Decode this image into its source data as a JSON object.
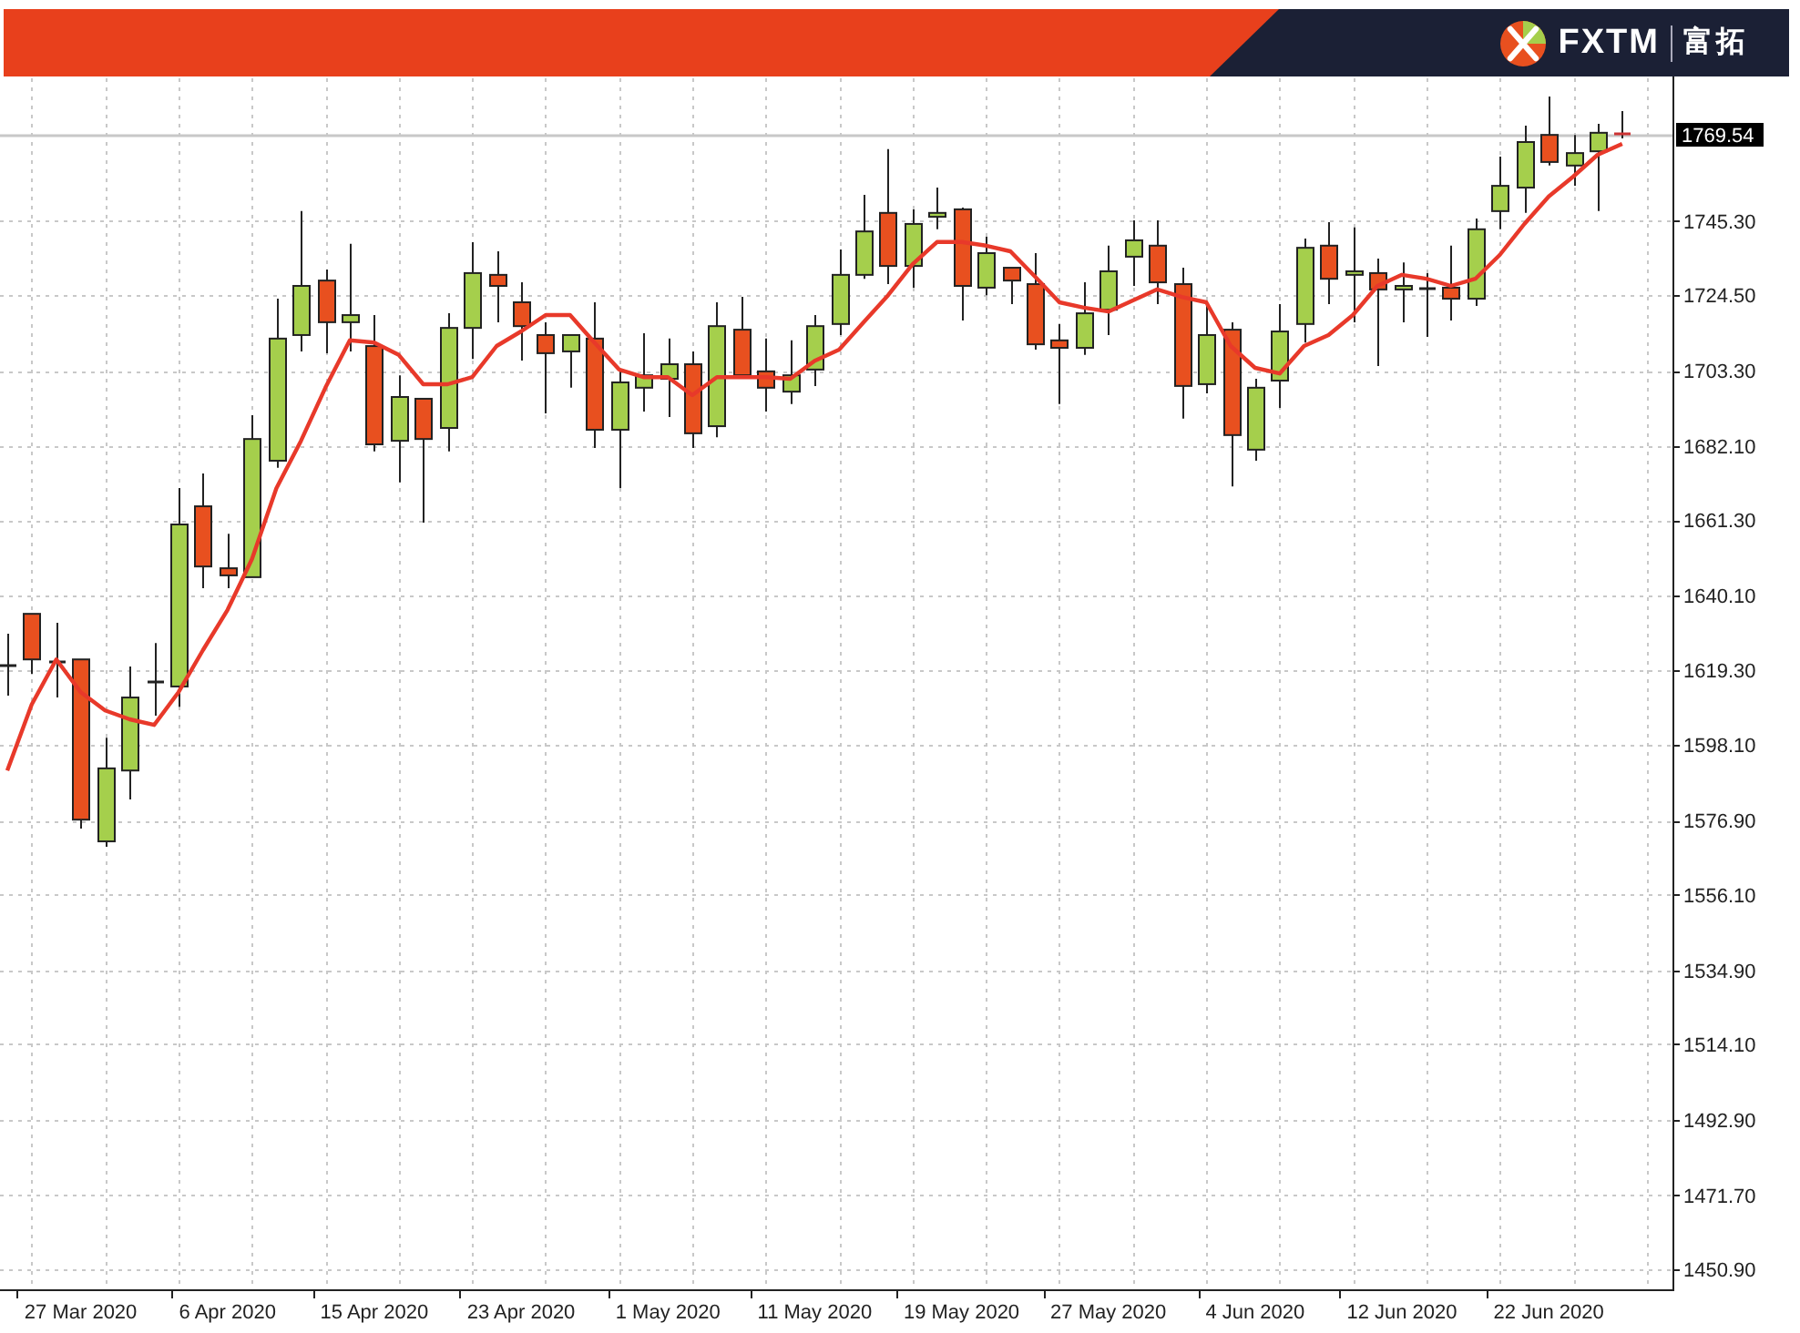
{
  "header": {
    "brand": "FXTM",
    "brand_chinese": "富拓"
  },
  "chart": {
    "chart_data": {
      "type": "candlestick",
      "grid": true,
      "ylim": [
        1445.3,
        1785.4
      ],
      "categories": [
        null,
        null,
        null,
        "27 Mar 2020",
        null,
        null,
        null,
        null,
        null,
        "6 Apr 2020",
        null,
        null,
        null,
        null,
        null,
        "15 Apr 2020",
        null,
        null,
        null,
        null,
        null,
        "23 Apr 2020",
        null,
        null,
        null,
        null,
        null,
        "1 May 2020",
        null,
        null,
        null,
        null,
        null,
        "11 May 2020",
        null,
        null,
        null,
        null,
        null,
        "19 May 2020",
        null,
        null,
        null,
        null,
        null,
        "27 May 2020",
        null,
        null,
        null,
        null,
        null,
        "4 Jun 2020",
        null,
        null,
        null,
        null,
        null,
        "12 Jun 2020",
        null,
        null,
        null,
        null,
        null,
        "22 Jun 2020",
        null,
        null,
        null
      ],
      "yticks": [
        {
          "value": 1745.3,
          "label": "1745.30"
        },
        {
          "value": 1724.5,
          "label": "1724.50"
        },
        {
          "value": 1703.3,
          "label": "1703.30"
        },
        {
          "value": 1682.1,
          "label": "1682.10"
        },
        {
          "value": 1661.3,
          "label": "1661.30"
        },
        {
          "value": 1640.1,
          "label": "1640.10"
        },
        {
          "value": 1619.3,
          "label": "1619.30"
        },
        {
          "value": 1598.1,
          "label": "1598.10"
        },
        {
          "value": 1576.9,
          "label": "1576.90"
        },
        {
          "value": 1556.1,
          "label": "1556.10"
        },
        {
          "value": 1534.9,
          "label": "1534.90"
        },
        {
          "value": 1514.1,
          "label": "1514.10"
        },
        {
          "value": 1492.9,
          "label": "1492.90"
        },
        {
          "value": 1471.7,
          "label": "1471.70"
        },
        {
          "value": 1450.9,
          "label": "1450.90"
        }
      ],
      "ohlc": [
        [
          1620.7,
          1629.4,
          1612.0,
          1620.7
        ],
        [
          1635.0,
          1635.0,
          1618.1,
          1622.2
        ],
        [
          1621.7,
          1632.5,
          1611.5,
          1621.7
        ],
        [
          1622.2,
          1622.2,
          1574.7,
          1577.2
        ],
        [
          1571.1,
          1600.2,
          1569.6,
          1591.6
        ],
        [
          1591.0,
          1620.2,
          1582.9,
          1611.5
        ],
        [
          1616.1,
          1626.8,
          1606.4,
          1616.1
        ],
        [
          1614.6,
          1670.3,
          1608.9,
          1660.1
        ],
        [
          1665.2,
          1674.4,
          1642.2,
          1648.3
        ],
        [
          1647.8,
          1657.5,
          1642.2,
          1645.8
        ],
        [
          1645.3,
          1690.8,
          1645.3,
          1684.1
        ],
        [
          1678.0,
          1723.5,
          1676.0,
          1712.3
        ],
        [
          1713.3,
          1748.1,
          1708.7,
          1727.1
        ],
        [
          1728.6,
          1731.7,
          1708.2,
          1716.9
        ],
        [
          1716.9,
          1738.9,
          1708.7,
          1718.9
        ],
        [
          1710.2,
          1718.9,
          1680.6,
          1682.6
        ],
        [
          1683.6,
          1702.0,
          1671.9,
          1695.9
        ],
        [
          1695.4,
          1695.4,
          1660.6,
          1684.1
        ],
        [
          1687.2,
          1719.4,
          1680.6,
          1715.3
        ],
        [
          1715.3,
          1739.4,
          1706.6,
          1730.7
        ],
        [
          1730.2,
          1736.8,
          1716.9,
          1727.1
        ],
        [
          1722.5,
          1728.1,
          1706.1,
          1715.8
        ],
        [
          1713.3,
          1716.9,
          1691.3,
          1708.2
        ],
        [
          1708.7,
          1713.3,
          1698.5,
          1713.3
        ],
        [
          1712.3,
          1722.5,
          1681.6,
          1686.7
        ],
        [
          1686.7,
          1703.6,
          1670.3,
          1700.0
        ],
        [
          1698.5,
          1713.8,
          1691.8,
          1702.0
        ],
        [
          1701.0,
          1712.3,
          1690.3,
          1705.1
        ],
        [
          1705.1,
          1708.7,
          1681.6,
          1685.7
        ],
        [
          1687.7,
          1722.5,
          1684.6,
          1715.8
        ],
        [
          1714.8,
          1724.0,
          1702.0,
          1702.0
        ],
        [
          1703.1,
          1712.3,
          1691.8,
          1698.5
        ],
        [
          1697.4,
          1711.8,
          1693.9,
          1702.0
        ],
        [
          1703.6,
          1718.9,
          1699.0,
          1715.8
        ],
        [
          1716.4,
          1737.3,
          1713.3,
          1730.2
        ],
        [
          1730.2,
          1752.7,
          1729.1,
          1742.4
        ],
        [
          1747.6,
          1765.5,
          1727.6,
          1732.7
        ],
        [
          1732.7,
          1748.6,
          1726.6,
          1744.5
        ],
        [
          1746.5,
          1754.7,
          1743.0,
          1747.6
        ],
        [
          1748.6,
          1749.1,
          1717.4,
          1727.1
        ],
        [
          1726.6,
          1740.9,
          1724.5,
          1736.3
        ],
        [
          1732.2,
          1732.2,
          1722.0,
          1728.6
        ],
        [
          1727.6,
          1736.3,
          1709.2,
          1710.7
        ],
        [
          1711.8,
          1716.4,
          1693.9,
          1709.7
        ],
        [
          1709.7,
          1728.1,
          1707.7,
          1719.4
        ],
        [
          1720.4,
          1738.4,
          1713.3,
          1731.2
        ],
        [
          1735.3,
          1745.5,
          1727.1,
          1739.9
        ],
        [
          1738.4,
          1745.5,
          1722.0,
          1728.1
        ],
        [
          1727.6,
          1732.2,
          1689.8,
          1699.0
        ],
        [
          1699.5,
          1721.5,
          1696.9,
          1713.3
        ],
        [
          1714.8,
          1716.9,
          1670.8,
          1685.2
        ],
        [
          1681.1,
          1701.0,
          1678.0,
          1698.5
        ],
        [
          1700.5,
          1722.0,
          1692.8,
          1714.3
        ],
        [
          1716.4,
          1740.4,
          1711.2,
          1737.8
        ],
        [
          1738.4,
          1745.0,
          1722.0,
          1729.1
        ],
        [
          1730.2,
          1743.5,
          1716.9,
          1731.2
        ],
        [
          1730.7,
          1734.8,
          1704.6,
          1726.1
        ],
        [
          1726.1,
          1733.7,
          1716.9,
          1727.1
        ],
        [
          1726.1,
          1730.7,
          1712.8,
          1726.6
        ],
        [
          1726.6,
          1738.4,
          1717.4,
          1723.5
        ],
        [
          1723.5,
          1746.0,
          1721.5,
          1743.0
        ],
        [
          1748.1,
          1763.4,
          1743.0,
          1755.2
        ],
        [
          1754.7,
          1772.1,
          1747.6,
          1767.5
        ],
        [
          1769.5,
          1780.3,
          1760.9,
          1761.9
        ],
        [
          1760.9,
          1769.5,
          1755.2,
          1764.4
        ],
        [
          1764.9,
          1772.6,
          1748.1,
          1770.1
        ],
        [
          1770.1,
          1776.2,
          1768.5,
          1769.5
        ]
      ],
      "series": [
        {
          "type": "line",
          "color": "#e8392a",
          "values": [
            1591.0,
            1609.5,
            1622.2,
            1613.0,
            1607.9,
            1605.4,
            1603.8,
            1613.0,
            1624.8,
            1636.1,
            1650.4,
            1670.3,
            1683.6,
            1698.5,
            1711.8,
            1711.2,
            1707.7,
            1699.5,
            1699.5,
            1701.5,
            1710.2,
            1714.3,
            1718.9,
            1718.9,
            1711.2,
            1703.6,
            1701.5,
            1701.5,
            1696.4,
            1701.5,
            1701.5,
            1701.5,
            1701.0,
            1706.1,
            1709.2,
            1716.9,
            1724.5,
            1733.2,
            1739.4,
            1739.4,
            1738.4,
            1736.8,
            1729.7,
            1722.5,
            1721.0,
            1719.9,
            1723.0,
            1726.1,
            1724.0,
            1722.5,
            1710.2,
            1704.1,
            1702.5,
            1710.2,
            1713.3,
            1718.9,
            1727.1,
            1730.2,
            1729.1,
            1727.1,
            1729.1,
            1735.8,
            1744.5,
            1752.2,
            1757.8,
            1763.9,
            1767.0
          ]
        }
      ],
      "ref_lines": [
        {
          "axis": "y",
          "value": 1769.54,
          "label": "1769.54"
        }
      ]
    }
  }
}
